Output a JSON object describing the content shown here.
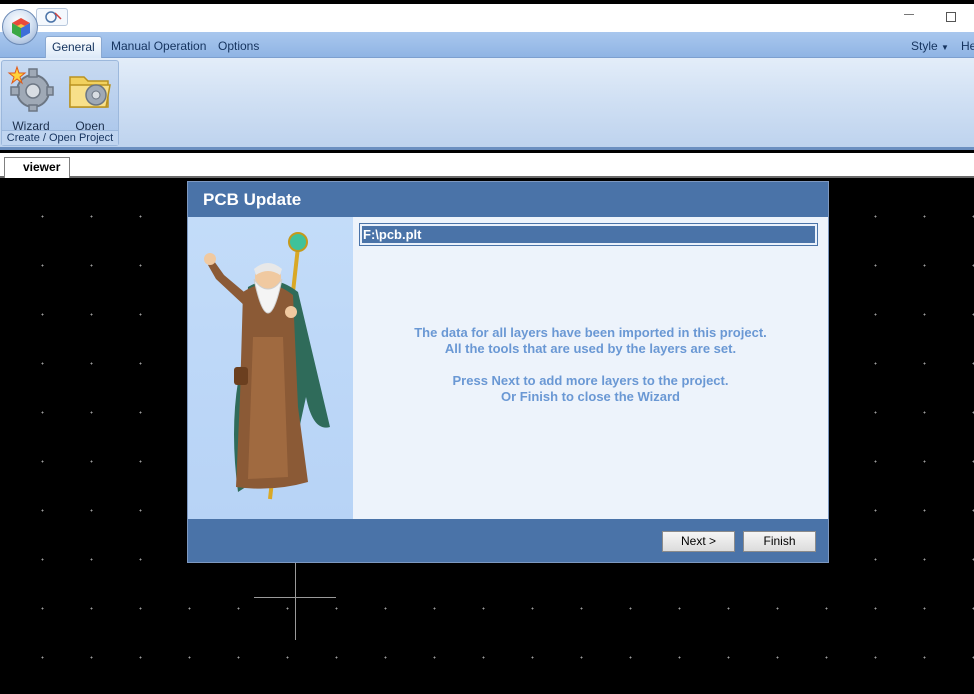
{
  "ribbon": {
    "tabs": [
      {
        "label": "General",
        "active": true
      },
      {
        "label": "Manual Operation",
        "active": false
      },
      {
        "label": "Options",
        "active": false
      }
    ],
    "right_items": {
      "style": "Style",
      "help": "He"
    },
    "group": {
      "caption": "Create / Open Project",
      "buttons": [
        {
          "label": "Wizard",
          "icon": "wizard-gear-icon"
        },
        {
          "label": "Open",
          "icon": "open-folder-gear-icon"
        }
      ]
    }
  },
  "document_tab": {
    "label": "viewer"
  },
  "dialog": {
    "title": "PCB Update",
    "file_path": "F:\\pcb.plt",
    "message_lines": [
      "The data for all  layers have been imported in this project.",
      "All the tools that are used by the layers are set.",
      "Press Next to add more layers to the project.",
      "Or Finish to close the Wizard"
    ],
    "buttons": {
      "next": "Next >",
      "finish": "Finish"
    },
    "accent_color": "#4a73a8",
    "message_color": "#6a98d4"
  }
}
